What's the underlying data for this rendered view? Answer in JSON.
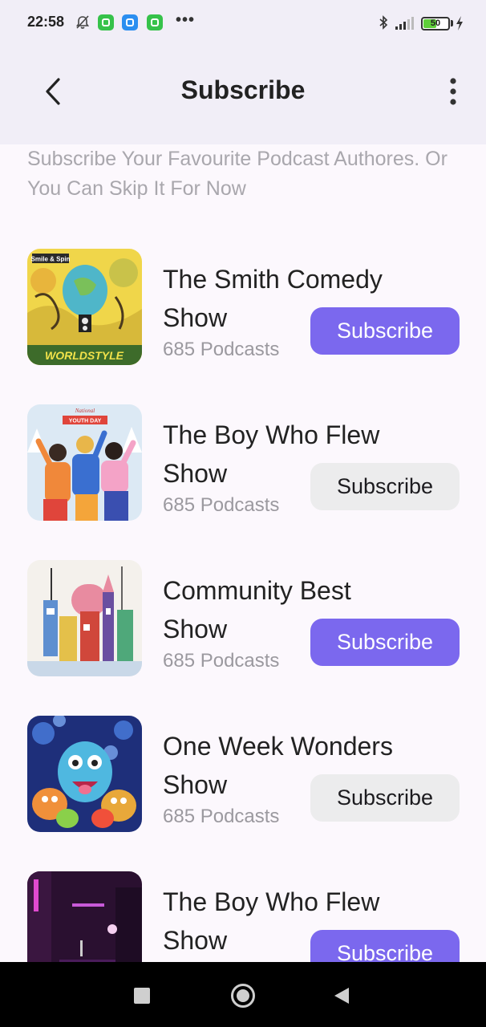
{
  "status_bar": {
    "time": "22:58",
    "battery_level": "50",
    "icons": [
      "notifications-off-icon",
      "app-icon",
      "app-icon",
      "app-icon",
      "more-icon",
      "bluetooth-icon",
      "signal-icon",
      "battery-icon",
      "charging-icon"
    ]
  },
  "header": {
    "title": "Subscribe",
    "back_icon": "arrow-back-icon",
    "menu_icon": "more-vert-icon"
  },
  "subtitle": "Subscribe Your Favourite Podcast Authores. Or You Can Skip It For Now",
  "items": [
    {
      "title": "The Smith Comedy Show",
      "count": "685 Podcasts",
      "button": "Subscribe",
      "button_style": "filled"
    },
    {
      "title": "The Boy Who Flew Show",
      "count": "685 Podcasts",
      "button": "Subscribe",
      "button_style": "outlined"
    },
    {
      "title": "Community Best Show",
      "count": "685 Podcasts",
      "button": "Subscribe",
      "button_style": "filled"
    },
    {
      "title": "One Week Wonders Show",
      "count": "685 Podcasts",
      "button": "Subscribe",
      "button_style": "outlined"
    },
    {
      "title": "The Boy Who Flew Show",
      "count": "",
      "button": "Subscribe",
      "button_style": "filled"
    }
  ],
  "artwork_text": {
    "worldstyle_logo": "Smile & Spin",
    "worldstyle_label": "WORLDSTYLE",
    "youth_day_top": "National",
    "youth_day_banner": "YOUTH DAY"
  },
  "colors": {
    "accent": "#7b68ee",
    "secondary_button": "#ececed",
    "app_bar": "#f1eef7",
    "background": "#fcf8fd",
    "subtitle_text": "#a9a7ad"
  },
  "nav_bar": {
    "icons": [
      "recents-square-icon",
      "home-circle-icon",
      "back-triangle-icon"
    ]
  }
}
